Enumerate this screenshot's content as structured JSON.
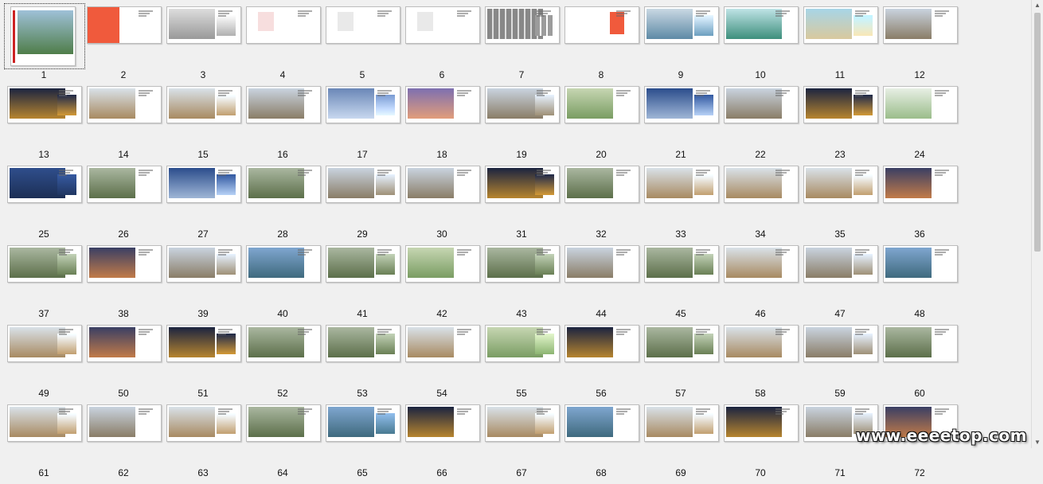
{
  "slides": [
    {
      "num": "1",
      "kind": "cover",
      "selected": true
    },
    {
      "num": "2",
      "kind": "red-title"
    },
    {
      "num": "3",
      "kind": "sketch"
    },
    {
      "num": "4",
      "kind": "map-red"
    },
    {
      "num": "5",
      "kind": "text-cols"
    },
    {
      "num": "6",
      "kind": "text-cols"
    },
    {
      "num": "7",
      "kind": "grid-photos"
    },
    {
      "num": "8",
      "kind": "red-badge"
    },
    {
      "num": "9",
      "kind": "aerial"
    },
    {
      "num": "10",
      "kind": "plan-blue"
    },
    {
      "num": "11",
      "kind": "plan-beach"
    },
    {
      "num": "12",
      "kind": "towers"
    },
    {
      "num": "13",
      "kind": "night"
    },
    {
      "num": "14",
      "kind": "villa"
    },
    {
      "num": "15",
      "kind": "villa"
    },
    {
      "num": "16",
      "kind": "towers"
    },
    {
      "num": "17",
      "kind": "futuristic"
    },
    {
      "num": "18",
      "kind": "sunset"
    },
    {
      "num": "19",
      "kind": "towers"
    },
    {
      "num": "20",
      "kind": "plan-green"
    },
    {
      "num": "21",
      "kind": "blue-towers"
    },
    {
      "num": "22",
      "kind": "towers"
    },
    {
      "num": "23",
      "kind": "night"
    },
    {
      "num": "24",
      "kind": "sketch-plan"
    },
    {
      "num": "25",
      "kind": "lake"
    },
    {
      "num": "26",
      "kind": "aerial-green"
    },
    {
      "num": "27",
      "kind": "blue-towers"
    },
    {
      "num": "28",
      "kind": "aerial-green"
    },
    {
      "num": "29",
      "kind": "towers"
    },
    {
      "num": "30",
      "kind": "towers"
    },
    {
      "num": "31",
      "kind": "night"
    },
    {
      "num": "32",
      "kind": "aerial-green"
    },
    {
      "num": "33",
      "kind": "villa"
    },
    {
      "num": "34",
      "kind": "villa"
    },
    {
      "num": "35",
      "kind": "villa"
    },
    {
      "num": "36",
      "kind": "dusk"
    },
    {
      "num": "37",
      "kind": "aerial-green"
    },
    {
      "num": "38",
      "kind": "dusk"
    },
    {
      "num": "39",
      "kind": "towers"
    },
    {
      "num": "40",
      "kind": "aerial-blue"
    },
    {
      "num": "41",
      "kind": "aerial-green"
    },
    {
      "num": "42",
      "kind": "plan-green"
    },
    {
      "num": "43",
      "kind": "aerial-green"
    },
    {
      "num": "44",
      "kind": "towers"
    },
    {
      "num": "45",
      "kind": "aerial-green"
    },
    {
      "num": "46",
      "kind": "villa"
    },
    {
      "num": "47",
      "kind": "towers"
    },
    {
      "num": "48",
      "kind": "aerial-blue"
    },
    {
      "num": "49",
      "kind": "villa"
    },
    {
      "num": "50",
      "kind": "dusk"
    },
    {
      "num": "51",
      "kind": "night"
    },
    {
      "num": "52",
      "kind": "aerial-green"
    },
    {
      "num": "53",
      "kind": "aerial-green"
    },
    {
      "num": "54",
      "kind": "villa"
    },
    {
      "num": "55",
      "kind": "plan-green"
    },
    {
      "num": "56",
      "kind": "night"
    },
    {
      "num": "57",
      "kind": "aerial-green"
    },
    {
      "num": "58",
      "kind": "villa"
    },
    {
      "num": "59",
      "kind": "towers"
    },
    {
      "num": "60",
      "kind": "aerial-green"
    },
    {
      "num": "61",
      "kind": "villa"
    },
    {
      "num": "62",
      "kind": "towers"
    },
    {
      "num": "63",
      "kind": "villa"
    },
    {
      "num": "64",
      "kind": "aerial-green"
    },
    {
      "num": "65",
      "kind": "aerial-blue"
    },
    {
      "num": "66",
      "kind": "night"
    },
    {
      "num": "67",
      "kind": "villa"
    },
    {
      "num": "68",
      "kind": "aerial-blue"
    },
    {
      "num": "69",
      "kind": "villa"
    },
    {
      "num": "70",
      "kind": "night"
    },
    {
      "num": "71",
      "kind": "towers"
    },
    {
      "num": "72",
      "kind": "dusk"
    }
  ],
  "watermark": "www.eeeetop.com",
  "scroll_icons": {
    "up": "arrow-up-icon",
    "down": "arrow-down-icon"
  }
}
